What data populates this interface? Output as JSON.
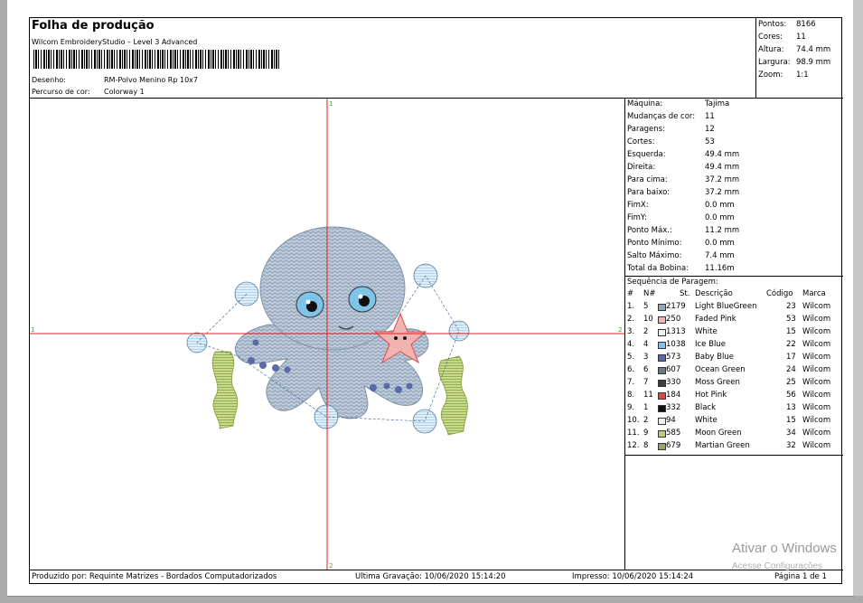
{
  "header": {
    "title": "Folha de produção",
    "software": "Wilcom EmbroideryStudio – Level 3 Advanced",
    "design_label": "Desenho:",
    "design_value": "RM-Polvo Menino Rp 10x7",
    "colorway_label": "Percurso de cor:",
    "colorway_value": "Colorway 1"
  },
  "stats": [
    {
      "label": "Pontos:",
      "value": "8166"
    },
    {
      "label": "Cores:",
      "value": "11"
    },
    {
      "label": "Altura:",
      "value": "74.4 mm"
    },
    {
      "label": "Largura:",
      "value": "98.9 mm"
    },
    {
      "label": "Zoom:",
      "value": "1:1"
    }
  ],
  "machine": [
    {
      "label": "Máquina:",
      "value": "Tajima"
    },
    {
      "label": "Mudanças de cor:",
      "value": "11"
    },
    {
      "label": "Paragens:",
      "value": "12"
    },
    {
      "label": "Cortes:",
      "value": "53"
    },
    {
      "label": "Esquerda:",
      "value": "49.4 mm"
    },
    {
      "label": "Direita:",
      "value": "49.4 mm"
    },
    {
      "label": "Para cima:",
      "value": "37.2 mm"
    },
    {
      "label": "Para baixo:",
      "value": "37.2 mm"
    },
    {
      "label": "FimX:",
      "value": "0.0 mm"
    },
    {
      "label": "FimY:",
      "value": "0.0 mm"
    },
    {
      "label": "Ponto Máx.:",
      "value": "11.2 mm"
    },
    {
      "label": "Ponto Mínimo:",
      "value": "0.0 mm"
    },
    {
      "label": "Salto Máximo:",
      "value": "7.4 mm"
    },
    {
      "label": "Total da Bobina:",
      "value": "11.16m"
    }
  ],
  "sequence": {
    "title": "Sequência de Paragem:",
    "headers": {
      "num": "#",
      "n": "N#",
      "st": "St.",
      "desc": "Descrição",
      "code": "Código",
      "brand": "Marca"
    },
    "rows": [
      {
        "num": "1.",
        "n": "5",
        "color": "#8fa9bd",
        "st": "2179",
        "desc": "Light BlueGreen",
        "code": "23",
        "brand": "Wilcom"
      },
      {
        "num": "2.",
        "n": "10",
        "color": "#f2b4b0",
        "st": "250",
        "desc": "Faded Pink",
        "code": "53",
        "brand": "Wilcom"
      },
      {
        "num": "3.",
        "n": "2",
        "color": "#f0f0f0",
        "st": "1313",
        "desc": "White",
        "code": "15",
        "brand": "Wilcom"
      },
      {
        "num": "4.",
        "n": "4",
        "color": "#7ec3e8",
        "st": "1038",
        "desc": "Ice Blue",
        "code": "22",
        "brand": "Wilcom"
      },
      {
        "num": "5.",
        "n": "3",
        "color": "#5a6aa8",
        "st": "573",
        "desc": "Baby Blue",
        "code": "17",
        "brand": "Wilcom"
      },
      {
        "num": "6.",
        "n": "6",
        "color": "#6f7a86",
        "st": "607",
        "desc": "Ocean Green",
        "code": "24",
        "brand": "Wilcom"
      },
      {
        "num": "7.",
        "n": "7",
        "color": "#3c3f42",
        "st": "330",
        "desc": "Moss Green",
        "code": "25",
        "brand": "Wilcom"
      },
      {
        "num": "8.",
        "n": "11",
        "color": "#d94a4a",
        "st": "184",
        "desc": "Hot Pink",
        "code": "56",
        "brand": "Wilcom"
      },
      {
        "num": "9.",
        "n": "1",
        "color": "#111111",
        "st": "332",
        "desc": "Black",
        "code": "13",
        "brand": "Wilcom"
      },
      {
        "num": "10.",
        "n": "2",
        "color": "#f0f0f0",
        "st": "94",
        "desc": "White",
        "code": "15",
        "brand": "Wilcom"
      },
      {
        "num": "11.",
        "n": "9",
        "color": "#b7d36c",
        "st": "585",
        "desc": "Moon Green",
        "code": "34",
        "brand": "Wilcom"
      },
      {
        "num": "12.",
        "n": "8",
        "color": "#97a46a",
        "st": "679",
        "desc": "Martian Green",
        "code": "32",
        "brand": "Wilcom"
      }
    ]
  },
  "footer": {
    "produced": "Produzido por: Requinte Matrizes - Bordados Computadorizados",
    "saved": "Ultima Gravação: 10/06/2020 15:14:20",
    "printed": "Impresso: 10/06/2020 15:14:24",
    "page": "Página 1 de 1"
  },
  "axis_markers": {
    "top": "1",
    "bottom": "2",
    "left": "1",
    "right": "2"
  },
  "watermark": {
    "line1": "Ativar o Windows",
    "line2": "Acesse Configurações"
  },
  "colors": {
    "crosshair": "#e02020",
    "guide": "#40a040"
  }
}
